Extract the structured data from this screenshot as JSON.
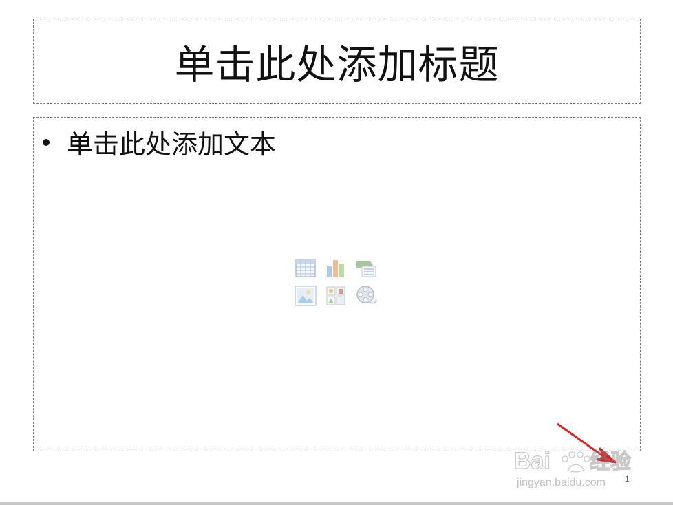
{
  "slide": {
    "title_placeholder": "单击此处添加标题",
    "content_placeholder": "单击此处添加文本",
    "page_number": "1"
  },
  "content_icons": [
    {
      "name": "insert-table-icon",
      "color": "#6b8fc7"
    },
    {
      "name": "insert-chart-icon",
      "color": "#e08a3a"
    },
    {
      "name": "insert-smartart-icon",
      "color": "#5a9c4a"
    },
    {
      "name": "insert-picture-icon",
      "color": "#6aa0d8"
    },
    {
      "name": "insert-clipart-icon",
      "color": "#d0902f"
    },
    {
      "name": "insert-media-icon",
      "color": "#7a8aa8"
    }
  ],
  "watermark": {
    "brand": "Baidu经验",
    "url": "jingyan.baidu.com"
  },
  "annotation": {
    "arrow_color": "#e02020"
  }
}
